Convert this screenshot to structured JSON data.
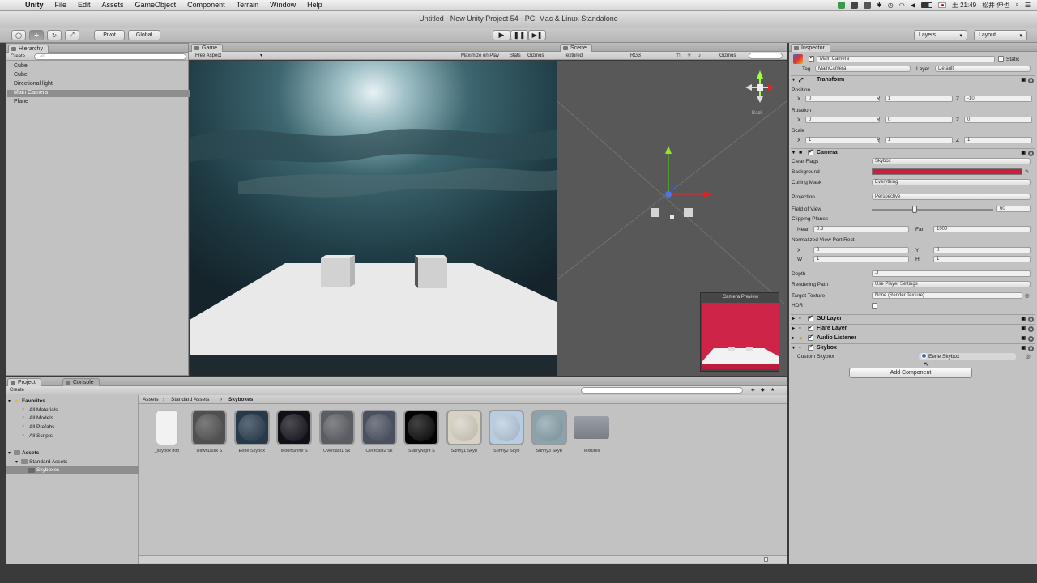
{
  "menubar": {
    "app": "Unity",
    "items": [
      "File",
      "Edit",
      "Assets",
      "GameObject",
      "Component",
      "Terrain",
      "Window",
      "Help"
    ],
    "clock": "土 21:49",
    "user": "松井 伸也"
  },
  "titlebar": {
    "title": "Untitled - New Unity Project 54 - PC, Mac & Linux Standalone"
  },
  "toolbar": {
    "pivot": "Pivot",
    "global": "Global",
    "layers": "Layers",
    "layout": "Layout"
  },
  "hierarchy": {
    "tab": "Hierarchy",
    "create": "Create",
    "search_placeholder": "All",
    "items": [
      "Cube",
      "Cube",
      "Directional light",
      "Main Camera",
      "Plane"
    ],
    "selected_index": 3
  },
  "game": {
    "tab": "Game",
    "aspect": "Free Aspect",
    "maximize": "Maximize on Play",
    "stats": "Stats",
    "gizmos": "Gizmos"
  },
  "scene": {
    "tab": "Scene",
    "shading": "Textured",
    "mode": "RGB",
    "gizmos": "Gizmos",
    "back_label": "Back",
    "camera_preview": "Camera Preview"
  },
  "inspector": {
    "tab": "Inspector",
    "object_name": "Main Camera",
    "static": "Static",
    "tag_label": "Tag",
    "tag": "MainCamera",
    "layer_label": "Layer",
    "layer": "Default",
    "transform": {
      "title": "Transform",
      "position": "Position",
      "rotation": "Rotation",
      "scale": "Scale",
      "pos": [
        "0",
        "1",
        "-10"
      ],
      "rot": [
        "0",
        "0",
        "0"
      ],
      "scl": [
        "1",
        "1",
        "1"
      ]
    },
    "camera": {
      "title": "Camera",
      "clear_flags_label": "Clear Flags",
      "clear_flags": "Skybox",
      "background_label": "Background",
      "background_color": "#c8203e",
      "culling_label": "Culling Mask",
      "culling": "Everything",
      "projection_label": "Projection",
      "projection": "Perspective",
      "fov_label": "Field of View",
      "fov": "60",
      "fov_fraction": 0.35,
      "clipping_label": "Clipping Planes",
      "near_label": "Near",
      "near": "0.3",
      "far_label": "Far",
      "far": "1000",
      "viewport_label": "Normalized View Port Rect",
      "vx": "0",
      "vy": "0",
      "vw": "1",
      "vh": "1",
      "depth_label": "Depth",
      "depth": "-1",
      "path_label": "Rendering Path",
      "path": "Use Player Settings",
      "target_label": "Target Texture",
      "target": "None (Render Texture)",
      "hdr_label": "HDR"
    },
    "components": [
      "GUILayer",
      "Flare Layer",
      "Audio Listener",
      "Skybox"
    ],
    "custom_skybox_label": "Custom Skybox",
    "custom_skybox": "Eerie Skybox",
    "add_component": "Add Component"
  },
  "project": {
    "tab": "Project",
    "tab2": "Console",
    "create": "Create",
    "favorites": "Favorites",
    "fav_items": [
      "All Materials",
      "All Models",
      "All Prefabs",
      "All Scripts"
    ],
    "assets": "Assets",
    "tree": [
      "Standard Assets",
      "Skyboxes"
    ],
    "breadcrumb": [
      "Assets",
      "Standard Assets",
      "Skyboxes"
    ],
    "asset_items": [
      {
        "label": "_skybox info",
        "color": "#f2f2f2"
      },
      {
        "label": "DawnDusk S",
        "color": "#505050"
      },
      {
        "label": "Eerie Skybox",
        "color": "#263a4c"
      },
      {
        "label": "MoonShine S",
        "color": "#101018"
      },
      {
        "label": "Overcast1 Sk",
        "color": "#5a5d62"
      },
      {
        "label": "Overcast2 Sk",
        "color": "#4a5060"
      },
      {
        "label": "StarryNight S",
        "color": "#040404"
      },
      {
        "label": "Sunny1 Skyb",
        "color": "#d8d2c4"
      },
      {
        "label": "Sunny2 Skyb",
        "color": "#b9cde0"
      },
      {
        "label": "Sunny3 Skyb",
        "color": "#8aa3ac"
      },
      {
        "label": "Textures",
        "color": "#7a7e84"
      }
    ]
  }
}
